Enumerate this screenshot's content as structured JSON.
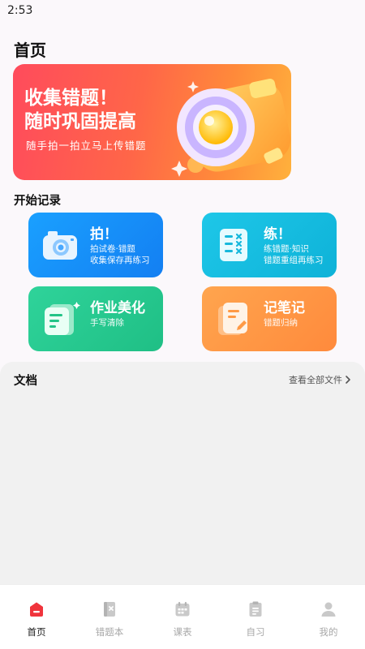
{
  "status_bar": {
    "time": "2:53"
  },
  "header": {
    "title": "首页"
  },
  "banner": {
    "title_line1": "收集错题！",
    "title_line2": "随时巩固提高",
    "subtitle": "随手拍一拍立马上传错题"
  },
  "record_section": {
    "title": "开始记录",
    "cards": [
      {
        "title": "拍！",
        "sub1": "拍试卷·错题",
        "sub2": "收集保存再练习",
        "icon": "camera-icon"
      },
      {
        "title": "练！",
        "sub1": "练错题·知识",
        "sub2": "错题重组再练习",
        "icon": "practice-sheet-icon"
      },
      {
        "title": "作业美化",
        "sub1": "手写清除",
        "sub2": "",
        "icon": "document-beautify-icon"
      },
      {
        "title": "记笔记",
        "sub1": "错题归纳",
        "sub2": "",
        "icon": "notebook-icon"
      }
    ]
  },
  "documents": {
    "title": "文档",
    "view_all": "查看全部文件"
  },
  "tabbar": {
    "items": [
      {
        "label": "首页",
        "icon": "home-icon",
        "active": true
      },
      {
        "label": "错题本",
        "icon": "mistake-book-icon",
        "active": false
      },
      {
        "label": "课表",
        "icon": "schedule-icon",
        "active": false
      },
      {
        "label": "自习",
        "icon": "self-study-icon",
        "active": false
      },
      {
        "label": "我的",
        "icon": "profile-icon",
        "active": false
      }
    ]
  },
  "colors": {
    "accent": "#f0343c",
    "card_blue": "#137ff2",
    "card_cyan": "#0eb2d8",
    "card_green": "#1fbf85",
    "card_orange": "#ff8a3c"
  }
}
